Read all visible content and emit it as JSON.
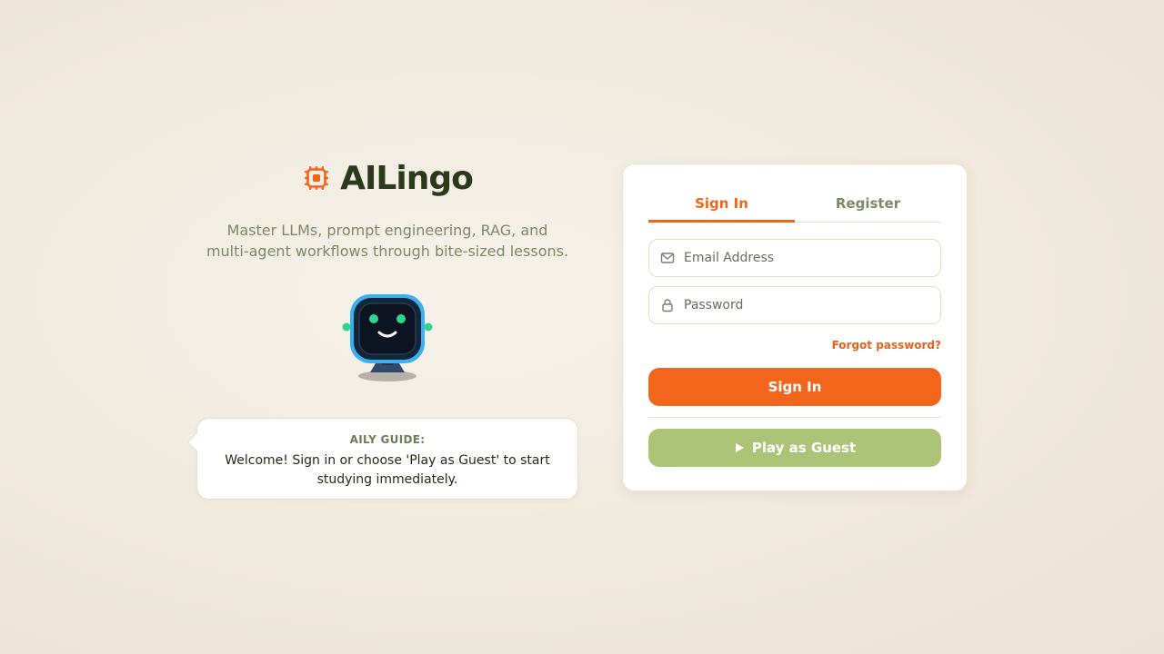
{
  "brand": {
    "name": "AILingo",
    "icon": "chip-icon",
    "color": "#f2661c"
  },
  "hero": {
    "tagline": "Master LLMs, prompt engineering, RAG, and multi-agent workflows through bite-sized lessons.",
    "mascot": "robot-mascot"
  },
  "guide": {
    "title": "AILY GUIDE:",
    "message": "Welcome! Sign in or choose 'Play as Guest' to start studying immediately."
  },
  "auth": {
    "tabs": [
      {
        "label": "Sign In",
        "active": true
      },
      {
        "label": "Register",
        "active": false
      }
    ],
    "email": {
      "placeholder": "Email Address",
      "value": "",
      "icon": "mail-icon"
    },
    "password": {
      "placeholder": "Password",
      "value": "",
      "icon": "lock-icon"
    },
    "forgot_label": "Forgot password?",
    "signin_label": "Sign In",
    "guest_label": "Play as Guest",
    "guest_icon": "play-icon"
  },
  "colors": {
    "accent": "#f2661c",
    "guest": "#adc378",
    "text_muted": "#7b8a64",
    "text_dark": "#2a3a1a"
  }
}
